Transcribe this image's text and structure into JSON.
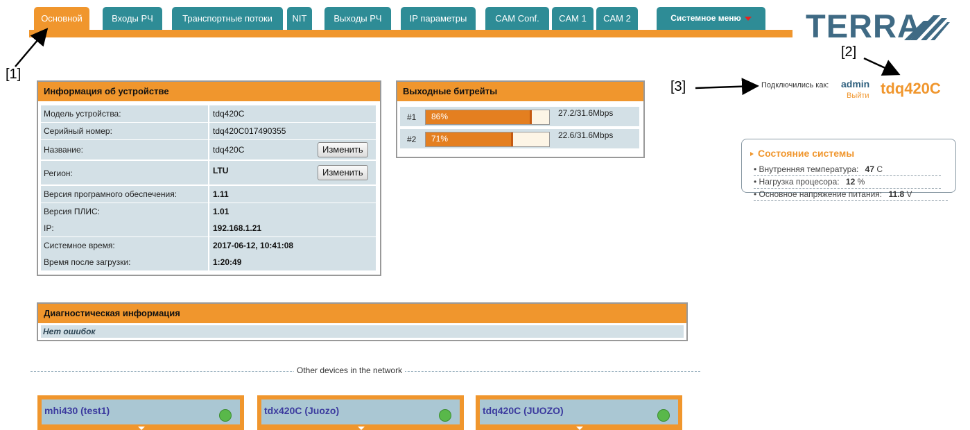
{
  "tabs": [
    {
      "label": "Основной",
      "active": true
    },
    {
      "label": "Входы РЧ"
    },
    {
      "label": "Транспортные потоки"
    },
    {
      "label": "NIT"
    },
    {
      "label": "Выходы РЧ"
    },
    {
      "label": "IP параметры"
    },
    {
      "label": "CAM Conf."
    },
    {
      "label": "CAM 1"
    },
    {
      "label": "CAM 2"
    },
    {
      "label": "Системное меню"
    }
  ],
  "logo": {
    "text": "TERRA"
  },
  "callouts": [
    "[1]",
    "[2]",
    "[3]"
  ],
  "login": {
    "label": "Подключились как:",
    "user": "admin",
    "exit": "Выйти",
    "device": "tdq420C"
  },
  "status": {
    "title": "Состояние системы",
    "rows": [
      {
        "label": "Внутренняя температура:",
        "value": "47",
        "unit": "C"
      },
      {
        "label": "Нагрузка процесора:",
        "value": "12",
        "unit": "%"
      },
      {
        "label": "Основное напряжение питания:",
        "value": "11.8",
        "unit": "V"
      }
    ]
  },
  "device_info": {
    "title": "Информация об устройстве",
    "change_label": "Изменить",
    "rows": [
      {
        "label": "Модель устройства:",
        "value": "tdq420C"
      },
      {
        "label": "Серийный номер:",
        "value": "tdq420C017490355"
      },
      {
        "label": "Название:",
        "value": "tdq420C"
      },
      {
        "label": "Регион:",
        "value": "LTU"
      },
      {
        "label": "Версия програмного обеспечения:",
        "value": "1.11"
      },
      {
        "label": "Версия ПЛИС:",
        "value": "1.01"
      },
      {
        "label": "IP:",
        "value": "192.168.1.21"
      },
      {
        "label": "Системное время:",
        "value": "2017-06-12, 10:41:08"
      },
      {
        "label": "Время после загрузки:",
        "value": "1:20:49"
      }
    ]
  },
  "bitrates": {
    "title": "Выходные битрейты",
    "rows": [
      {
        "index": "#1",
        "percent_label": "86%",
        "fill": 0.86,
        "text": "27.2/31.6Mbps"
      },
      {
        "index": "#2",
        "percent_label": "71%",
        "fill": 0.71,
        "text": "22.6/31.6Mbps"
      }
    ]
  },
  "diagnostics": {
    "title": "Диагностическая информация",
    "message": "Нет ошибок"
  },
  "network": {
    "divider": "Other devices in the network",
    "devices": [
      {
        "name": "mhi430 (test1)"
      },
      {
        "name": "tdx420C (Juozo)"
      },
      {
        "name": "tdq420C (JUOZO)"
      }
    ]
  },
  "colors": {
    "accent": "#f0962d",
    "tab": "#2e8c96",
    "row": "#d3e0e6",
    "brand": "#3f6a84"
  }
}
